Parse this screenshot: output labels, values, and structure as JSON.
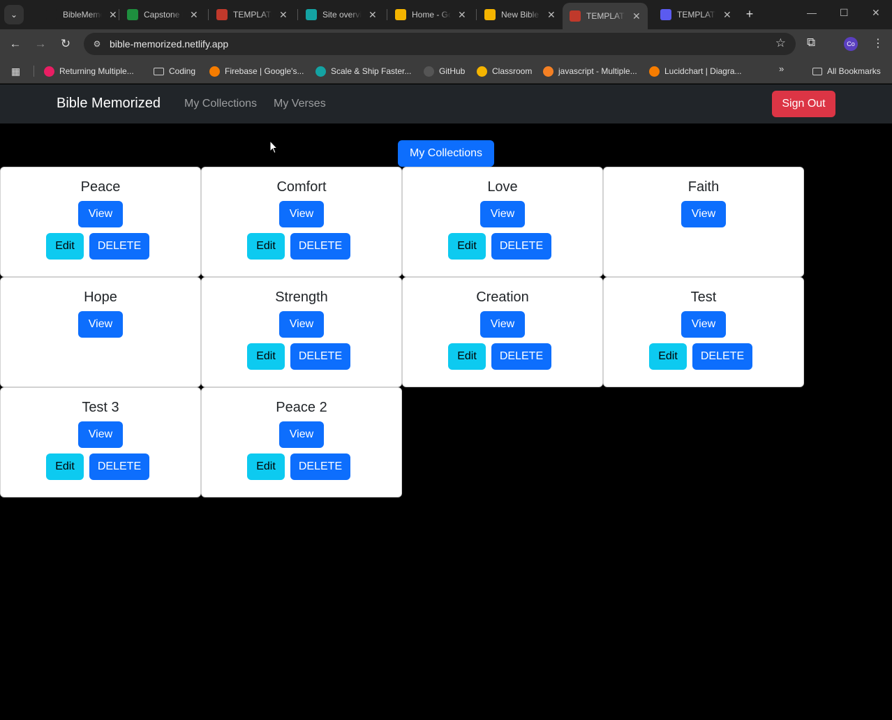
{
  "browser": {
    "tabs": [
      {
        "title": "BibleMemorized",
        "favicon": "bible-icon",
        "color": "#1f1f1f",
        "active": false
      },
      {
        "title": "Capstone Project",
        "favicon": "sheets-icon",
        "color": "#1e8e3e",
        "active": false
      },
      {
        "title": "TEMPLATE",
        "favicon": "chrome-icon",
        "color": "#c0392b",
        "active": false
      },
      {
        "title": "Site overview",
        "favicon": "netlify-icon",
        "color": "#14a3a3",
        "active": false
      },
      {
        "title": "Home - Google Drive",
        "favicon": "drive-icon",
        "color": "#f4b400",
        "active": false
      },
      {
        "title": "New Bible",
        "favicon": "slides-icon",
        "color": "#f4b400",
        "active": false
      },
      {
        "title": "TEMPLATE",
        "favicon": "chrome-icon",
        "color": "#c0392b",
        "active": true
      },
      {
        "title": "TEMPLATE",
        "favicon": "gear-icon",
        "color": "#5b5bf0",
        "active": false
      }
    ],
    "url": "bible-memorized.netlify.app",
    "profile_initials": "Co",
    "bookmarks": [
      {
        "label": "Returning Multiple...",
        "icon": "tumblr-icon",
        "color": "#e91e63"
      },
      {
        "label": "Coding",
        "icon": "folder-icon",
        "color": "#3c3c3c"
      },
      {
        "label": "Firebase | Google's...",
        "icon": "firebase-icon",
        "color": "#f57c00"
      },
      {
        "label": "Scale & Ship Faster...",
        "icon": "netlify-icon",
        "color": "#14a3a3"
      },
      {
        "label": "GitHub",
        "icon": "github-icon",
        "color": "#555555"
      },
      {
        "label": "Classroom",
        "icon": "classroom-icon",
        "color": "#f4b400"
      },
      {
        "label": "javascript - Multiple...",
        "icon": "stackoverflow-icon",
        "color": "#f48024"
      },
      {
        "label": "Lucidchart | Diagra...",
        "icon": "lucidchart-icon",
        "color": "#f57c00"
      }
    ],
    "all_bookmarks_label": "All Bookmarks"
  },
  "app": {
    "brand": "Bible Memorized",
    "nav_links": [
      "My Collections",
      "My Verses"
    ],
    "sign_out_label": "Sign Out",
    "page_button_label": "My Collections"
  },
  "labels": {
    "view": "View",
    "edit": "Edit",
    "delete": "DELETE"
  },
  "collections": [
    {
      "title": "Peace",
      "editable": true
    },
    {
      "title": "Comfort",
      "editable": true
    },
    {
      "title": "Love",
      "editable": true
    },
    {
      "title": "Faith",
      "editable": false
    },
    {
      "title": "Hope",
      "editable": false
    },
    {
      "title": "Strength",
      "editable": true
    },
    {
      "title": "Creation",
      "editable": true
    },
    {
      "title": "Test",
      "editable": true
    },
    {
      "title": "Test 3",
      "editable": true
    },
    {
      "title": "Peace 2",
      "editable": true
    }
  ],
  "colors": {
    "primary": "#0d6efd",
    "info": "#0dcaf0",
    "danger": "#dc3545",
    "navbar": "#212529"
  }
}
